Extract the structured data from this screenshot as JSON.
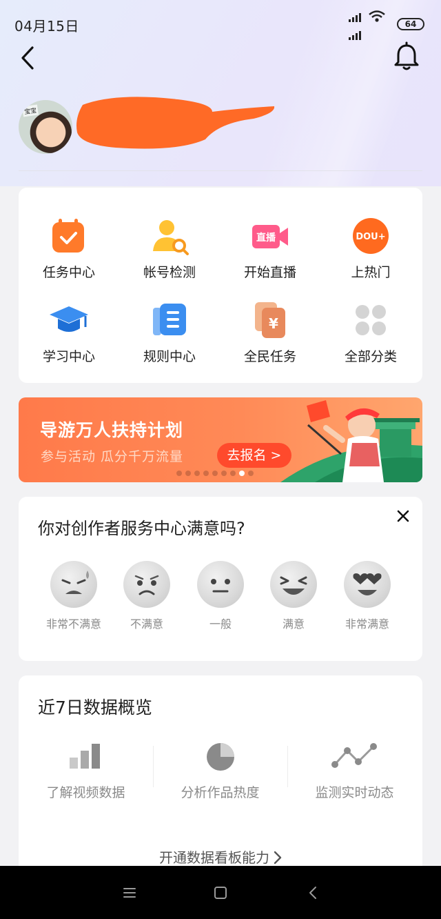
{
  "status_bar": {
    "time": "04月15日",
    "battery": "64"
  },
  "header": {
    "redacted_username": ""
  },
  "grid": [
    {
      "label": "任务中心",
      "icon": "task-center-icon"
    },
    {
      "label": "帐号检测",
      "icon": "account-check-icon"
    },
    {
      "label": "开始直播",
      "icon": "start-live-icon",
      "icon_text": "直播"
    },
    {
      "label": "上热门",
      "icon": "dou-plus-icon",
      "icon_text": "DOU+"
    },
    {
      "label": "学习中心",
      "icon": "learning-cap-icon"
    },
    {
      "label": "规则中心",
      "icon": "rules-book-icon"
    },
    {
      "label": "全民任务",
      "icon": "yuan-task-icon",
      "icon_text": "¥"
    },
    {
      "label": "全部分类",
      "icon": "all-categories-icon"
    }
  ],
  "banner": {
    "title": "导游万人扶持计划",
    "subtitle": "参与活动  瓜分千万流量",
    "button": "去报名 >",
    "dots_total": 9,
    "dots_active_index": 7
  },
  "survey": {
    "title": "你对创作者服务中心满意吗?",
    "options": [
      "非常不满意",
      "不满意",
      "一般",
      "满意",
      "非常满意"
    ]
  },
  "overview": {
    "title": "近7日数据概览",
    "items": [
      {
        "label": "了解视频数据",
        "icon": "bar-chart-icon"
      },
      {
        "label": "分析作品热度",
        "icon": "pie-chart-icon"
      },
      {
        "label": "监测实时动态",
        "icon": "line-trend-icon"
      }
    ],
    "link": "开通数据看板能力"
  },
  "colors": {
    "accent_orange": "#ff7a4a",
    "banner_button": "#ff4a2c",
    "page_bg": "#f2f2f4"
  }
}
